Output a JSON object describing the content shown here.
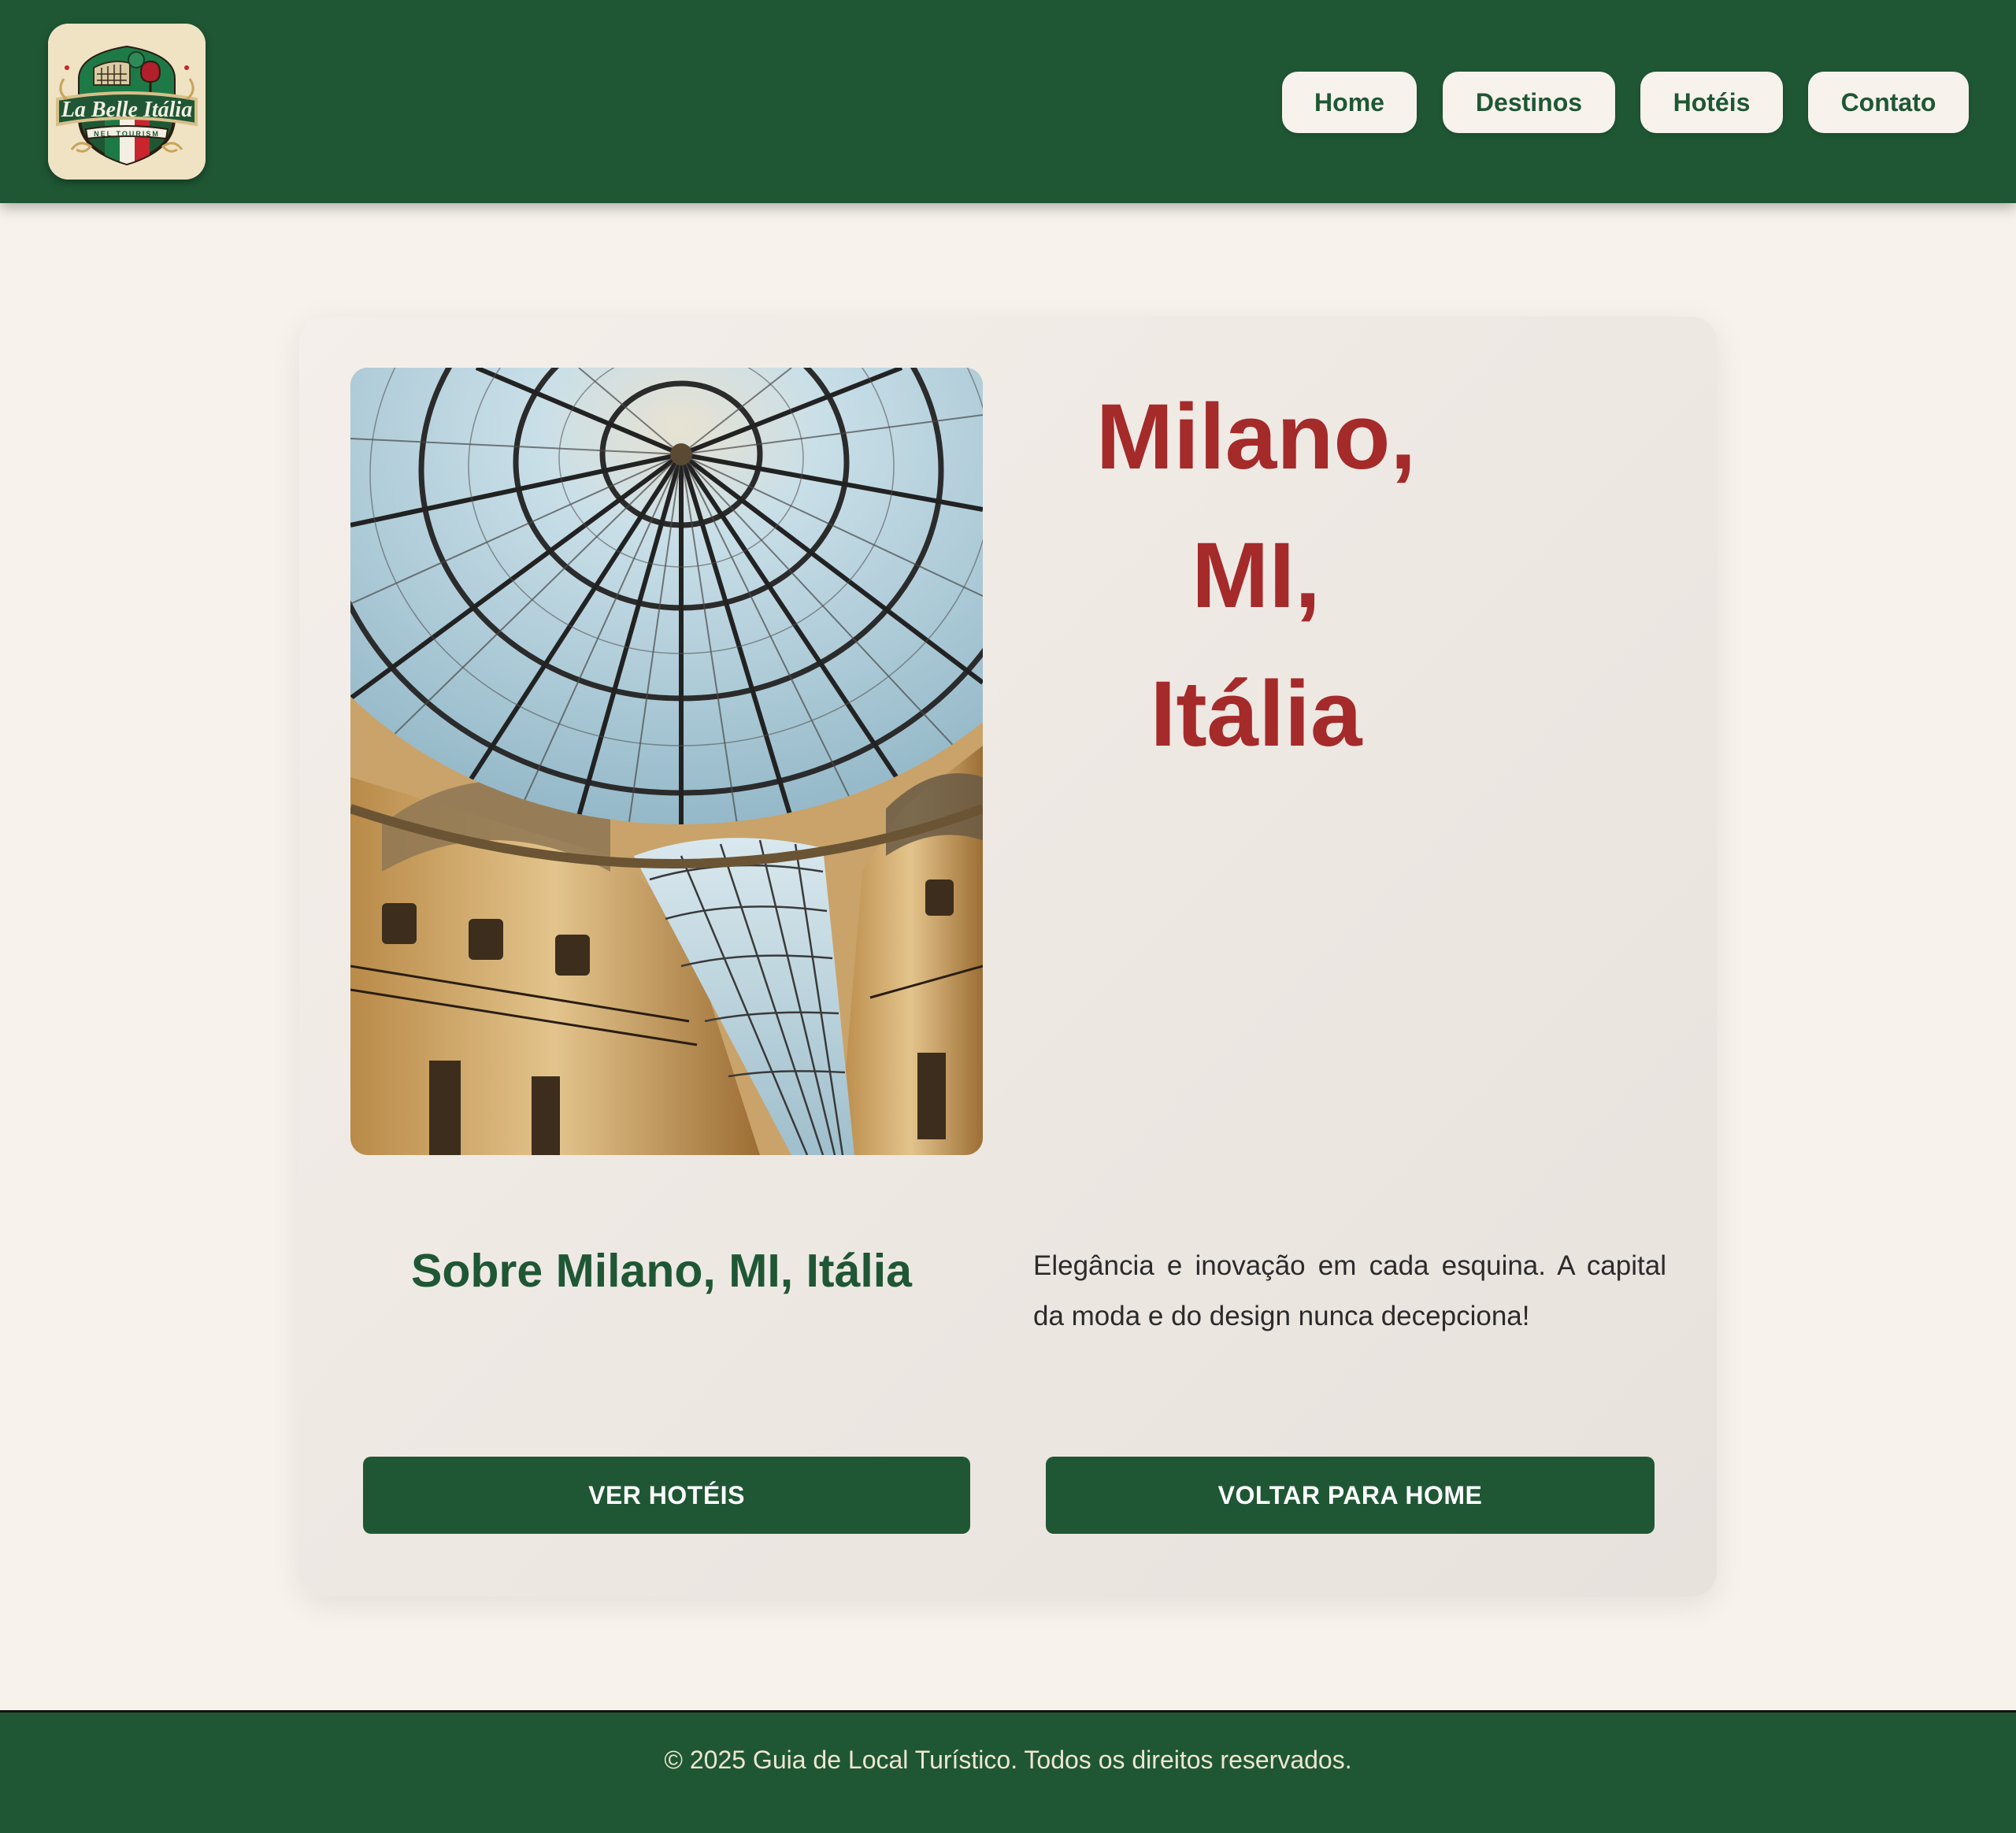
{
  "header": {
    "logo": {
      "icon": "la-belle-italia-logo",
      "text": "La Belle Itália",
      "tagline": "NEL TOURISM"
    },
    "nav": [
      {
        "label": "Home",
        "icon": "home"
      },
      {
        "label": "Destinos",
        "icon": "destinations"
      },
      {
        "label": "Hotéis",
        "icon": "hotels"
      },
      {
        "label": "Contato",
        "icon": "contact"
      }
    ]
  },
  "main": {
    "image": {
      "icon": "galleria-vittorio-emanuele-dome-photo"
    },
    "title_line1": "Milano, MI,",
    "title_line2": "Itália",
    "about_title": "Sobre Milano, MI, Itália",
    "about_text": "Elegância e inovação em cada esquina. A capital da moda e do design nunca decepciona!",
    "buttons": {
      "hotels": "VER HOTÉIS",
      "home": "VOLTAR PARA HOME"
    }
  },
  "footer": {
    "text": "© 2025 Guia de Local Turístico. Todos os direitos reservados."
  },
  "colors": {
    "primary_green": "#1f5734",
    "title_red": "#a52a2a",
    "background_cream": "#f7f2ec",
    "card_background": "#f0ebe6"
  }
}
